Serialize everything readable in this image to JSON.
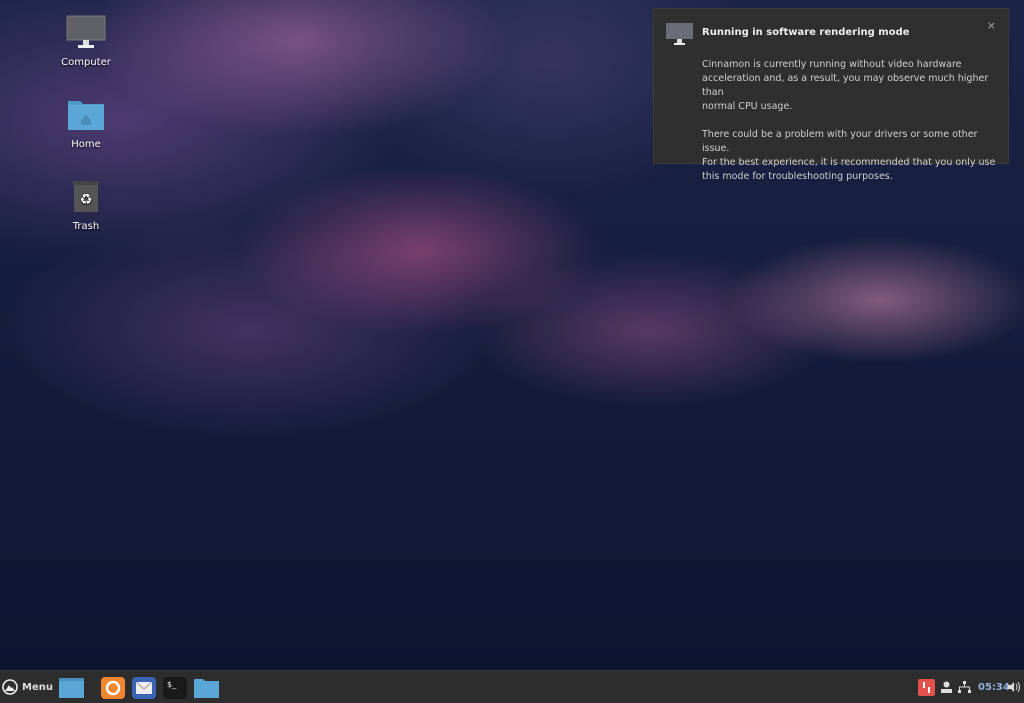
{
  "desktop": {
    "icons": [
      {
        "label": "Computer"
      },
      {
        "label": "Home"
      },
      {
        "label": "Trash"
      }
    ]
  },
  "notification": {
    "title": "Running in software rendering mode",
    "body": "Cinnamon is currently running without video hardware\nacceleration and, as a result, you may observe much higher than\nnormal CPU usage.\n\nThere could be a problem with your drivers or some other issue.\nFor the best experience, it is recommended that you only use\nthis mode for troubleshooting purposes.",
    "close": "×"
  },
  "taskbar": {
    "menu_label": "Menu",
    "clock": "05:34"
  },
  "colors": {
    "accent": "#5aa6d6",
    "taskbar": "#2d2d2d",
    "notification": "#2f2f2f"
  }
}
